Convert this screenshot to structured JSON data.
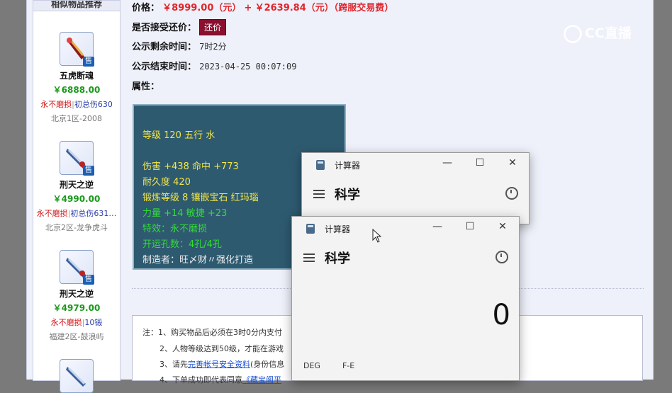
{
  "sidebar": {
    "header": "相似物品推荐",
    "items": [
      {
        "name": "五虎断魂",
        "price": "￥6888.00",
        "attr_red": "永不磨损",
        "attr_blue": "初总伤630",
        "server": "北京1区-2008",
        "sale": "售"
      },
      {
        "name": "刑天之逆",
        "price": "￥4990.00",
        "attr_red": "永不磨损",
        "attr_blue": "初总伤631…",
        "server": "北京2区-龙争虎斗",
        "sale": "售"
      },
      {
        "name": "刑天之逆",
        "price": "￥4979.00",
        "attr_red": "永不磨损",
        "attr_blue": "10锻",
        "server": "福建2区-鼓浪屿",
        "sale": "售"
      }
    ]
  },
  "info": {
    "price_label": "价格：",
    "price": "￥8999.00（元）",
    "plus": "+",
    "fee": "￥2639.84（元）（跨服交易费）",
    "bargain_label": "是否接受还价：",
    "bargain_button": "还价",
    "remain_label": "公示剩余时间：",
    "remain_value": "7时2分",
    "end_label": "公示结束时间：",
    "end_value": "2023-04-25 00:07:09",
    "attr_label": "属性："
  },
  "attributes": {
    "line1": "等级 120 五行 水",
    "line2": "伤害 +438 命中 +773",
    "line3": "耐久度 420",
    "line4": "锻炼等级 8 镶嵌宝石 红玛瑙",
    "line5": "力量 +14 敏捷 +23",
    "line6": "特效：永不磨损",
    "line7": "开运孔数：4孔/4孔",
    "line8": "制造者：旺〆财〃强化打造"
  },
  "notes": {
    "n1": "注：1、购买物品后必须在3时0分内支付",
    "n2": "2、人物等级达到50级，才能在游戏",
    "n3_prefix": "3、请先",
    "n3_link": "完善帐号安全资料",
    "n3_suffix": "(身份信息",
    "n4_prefix": "4、下单成功即代表同意",
    "n4_link": "《藏宝阁平"
  },
  "watermark": "CC直播",
  "calc_back": {
    "title": "计算器",
    "mode": "科学"
  },
  "calc_front": {
    "title": "计算器",
    "mode": "科学",
    "display": "0",
    "deg": "DEG",
    "fe": "F-E"
  },
  "icons": {
    "minimize": "—",
    "maximize": "☐",
    "close": "✕"
  }
}
